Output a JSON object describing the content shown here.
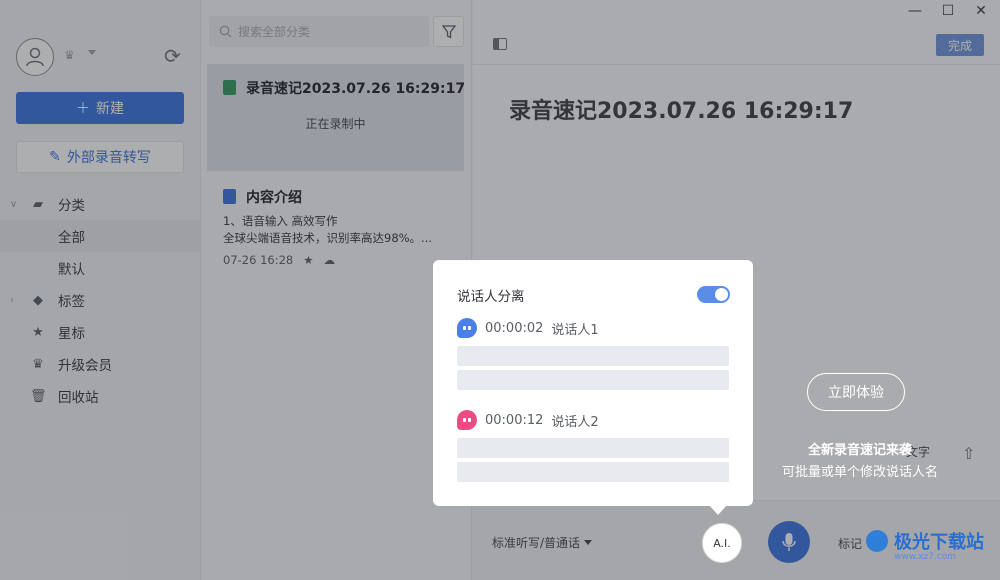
{
  "sidebar": {
    "new_label": "新建",
    "external_label": "外部录音转写",
    "nav": [
      {
        "label": "分类"
      },
      {
        "label": "全部"
      },
      {
        "label": "默认"
      },
      {
        "label": "标签"
      },
      {
        "label": "星标"
      },
      {
        "label": "升级会员"
      },
      {
        "label": "回收站"
      }
    ]
  },
  "list": {
    "search_placeholder": "搜索全部分类",
    "notes": [
      {
        "title": "录音速记2023.07.26 16:29:17",
        "status": "正在录制中"
      },
      {
        "title": "内容介绍",
        "line1": "1、语音输入 高效写作",
        "line2": "全球尖端语音技术，识别率高达98%。...",
        "date": "07-26 16:28"
      }
    ]
  },
  "editor": {
    "done_label": "完成",
    "title": "录音速记2023.07.26 16:29:17",
    "lang_label": "标准听写/普通话",
    "ai_label": "A.I.",
    "mark_label": "标记",
    "partial_text": "文字"
  },
  "overlay": {
    "try_label": "立即体验",
    "line1": "全新录音速记来袭",
    "line2": "可批量或单个修改说话人名"
  },
  "card": {
    "heading": "说话人分离",
    "toggle_on": true,
    "speakers": [
      {
        "time": "00:00:02",
        "name": "说话人1",
        "color": "#4a7fe8"
      },
      {
        "time": "00:00:12",
        "name": "说话人2",
        "color": "#ea4d84"
      }
    ]
  },
  "watermark": {
    "brand": "极光下载站",
    "url": "www.xz7.com"
  }
}
